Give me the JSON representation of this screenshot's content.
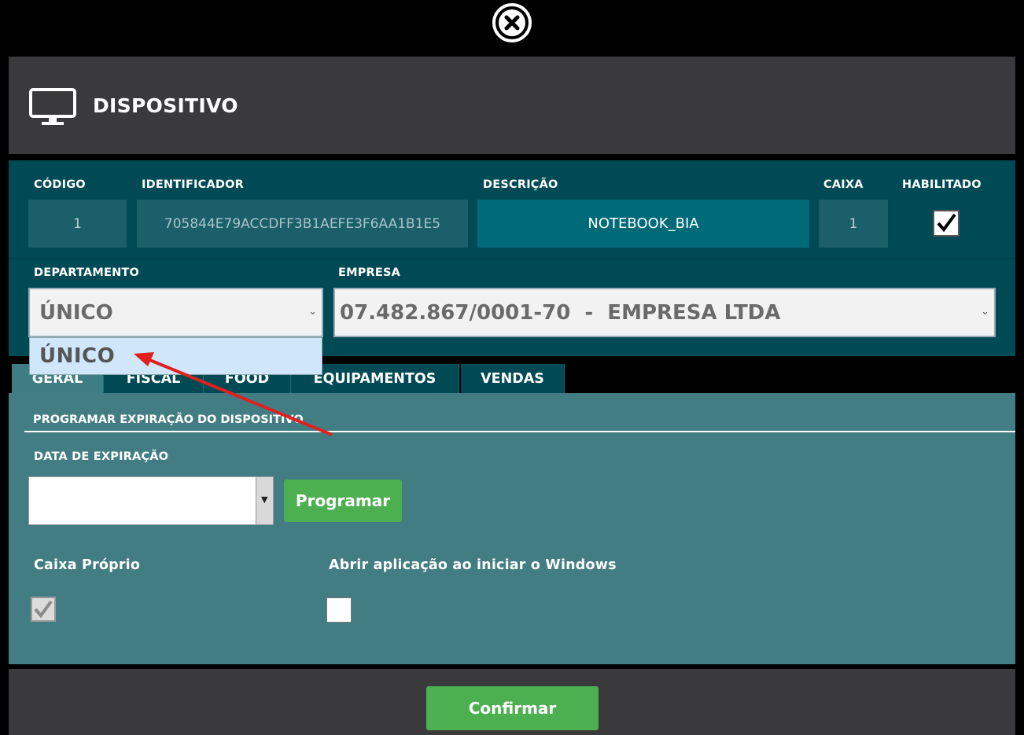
{
  "dialog": {
    "title": "DISPOSITIVO",
    "close_icon": "close-circle-icon",
    "header_icon": "monitor-icon"
  },
  "fields": {
    "codigo_label": "CÓDIGO",
    "codigo_value": "1",
    "identificador_label": "IDENTIFICADOR",
    "identificador_value": "705844E79ACCDFF3B1AEFE3F6AA1B1E5",
    "descricao_label": "DESCRIÇÃO",
    "descricao_value": "NOTEBOOK_BIA",
    "caixa_label": "CAIXA",
    "caixa_value": "1",
    "habilitado_label": "HABILITADO",
    "habilitado_checked": true,
    "departamento_label": "DEPARTAMENTO",
    "departamento_value": "ÚNICO",
    "departamento_options": [
      "ÚNICO"
    ],
    "empresa_label": "EMPRESA",
    "empresa_value": "07.482.867/0001-70  -  EMPRESA LTDA"
  },
  "tabs": [
    {
      "label": "GERAL",
      "active": true
    },
    {
      "label": "FISCAL",
      "active": false
    },
    {
      "label": "FOOD",
      "active": false
    },
    {
      "label": "EQUIPAMENTOS",
      "active": false
    },
    {
      "label": "VENDAS",
      "active": false
    }
  ],
  "geral": {
    "section_title": "PROGRAMAR EXPIRAÇÃO DO DISPOSITIVO",
    "data_expiracao_label": "DATA DE EXPIRAÇÃO",
    "data_expiracao_value": "",
    "programar_label": "Programar",
    "caixa_proprio_label": "Caixa Próprio",
    "caixa_proprio_checked": true,
    "abrir_label": "Abrir aplicação ao iniciar o Windows",
    "abrir_checked": false
  },
  "footer": {
    "confirmar_label": "Confirmar"
  },
  "colors": {
    "header_bg": "#3a3a3c",
    "teal_dark": "#004a55",
    "teal_panel": "#427d84",
    "green_button": "#4caf50",
    "annotation_arrow": "#e0201e"
  }
}
